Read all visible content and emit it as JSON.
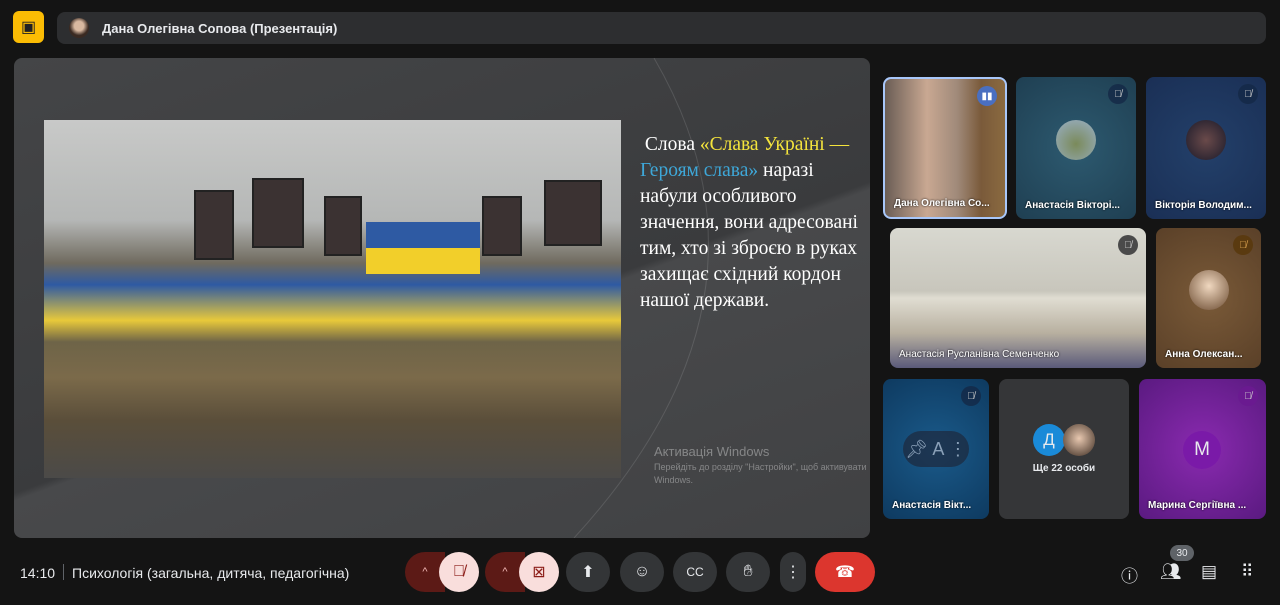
{
  "header": {
    "title": "Дана Олегівна Сопова (Презентація)",
    "presenting_icon": "present-off-icon"
  },
  "slide": {
    "text_parts": [
      "Слова ",
      "«Слава Україні — ",
      "Героям слава»",
      " наразі набули особливого значення, вони адресовані тим, хто зі зброєю в руках захищає східний кордон нашої держави."
    ],
    "watermark_title": "Активація Windows",
    "watermark_sub": "Перейдіть до розділу \"Настройки\", щоб активувати Windows.",
    "colors": {
      "yellow": "#f4e43c",
      "blue": "#3ea7d8"
    }
  },
  "participants": [
    {
      "name": "Дана Олегівна Со..."
    },
    {
      "name": "Анастасія Вікторі..."
    },
    {
      "name": "Вікторія Володим..."
    },
    {
      "name": "Анастасія Русланівна Семенченко"
    },
    {
      "name": "Анна Олексан..."
    },
    {
      "name": "Анастасія Вікт..."
    },
    {
      "name": "Ще 22 особи",
      "initial": "Д"
    },
    {
      "name": "Марина Сергіївна ...",
      "initial": "M"
    }
  ],
  "pinned_overlay": {
    "pin": "ꟼ",
    "letter": "A"
  },
  "footer": {
    "time": "14:10",
    "meeting": "Психологія (загальна, дитяча, педагогічна)",
    "people_count": "30"
  }
}
